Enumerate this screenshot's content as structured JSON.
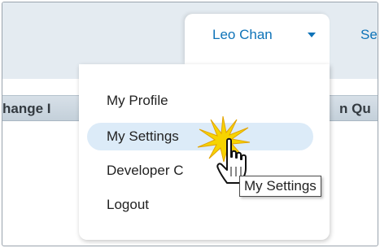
{
  "header": {
    "user_name": "Leo Chan",
    "setup_link": "Set"
  },
  "tabs": {
    "left_partial": "hange I",
    "right_partial": "n Qu"
  },
  "user_menu": {
    "items": [
      {
        "label": "My Profile"
      },
      {
        "label": "My Settings",
        "selected": true
      },
      {
        "label": "Developer C"
      },
      {
        "label": "Logout"
      }
    ]
  },
  "tooltip": {
    "text": "My Settings"
  },
  "icons": {
    "caret": "caret-down-icon",
    "cursor": "hand-pointer-cursor-icon",
    "click": "click-burst-icon"
  },
  "colors": {
    "link": "#0e73b8",
    "header_bg": "#e4ebf1",
    "highlight": "#dcebf8",
    "burst": "#f6d400"
  }
}
